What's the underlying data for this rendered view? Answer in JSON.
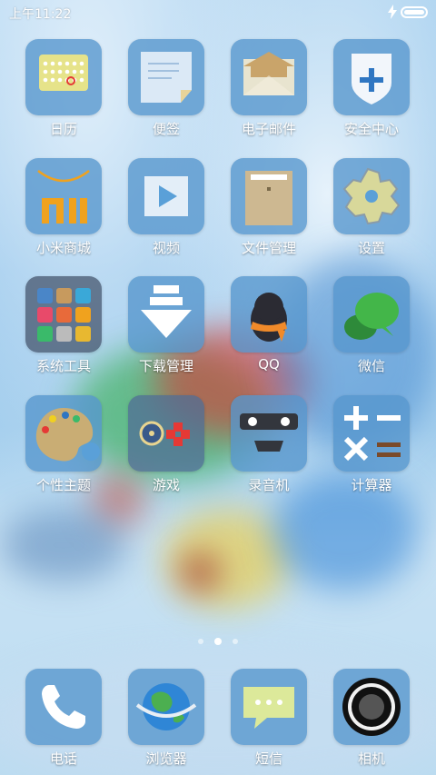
{
  "status_bar": {
    "time": "上午11:22",
    "charging": true,
    "battery_level": 1.0
  },
  "pager": {
    "page_count": 3,
    "active_page": 2
  },
  "apps": [
    {
      "label": "日历",
      "icon": "calendar-icon"
    },
    {
      "label": "便签",
      "icon": "notes-icon"
    },
    {
      "label": "电子邮件",
      "icon": "email-icon"
    },
    {
      "label": "安全中心",
      "icon": "security-icon"
    },
    {
      "label": "小米商城",
      "icon": "mi-store-icon"
    },
    {
      "label": "视频",
      "icon": "video-icon"
    },
    {
      "label": "文件管理",
      "icon": "file-manager-icon"
    },
    {
      "label": "设置",
      "icon": "settings-gear-icon"
    },
    {
      "label": "系统工具",
      "icon": "system-tools-folder-icon"
    },
    {
      "label": "下载管理",
      "icon": "download-icon"
    },
    {
      "label": "QQ",
      "icon": "qq-penguin-icon"
    },
    {
      "label": "微信",
      "icon": "wechat-icon"
    },
    {
      "label": "个性主题",
      "icon": "theme-palette-icon"
    },
    {
      "label": "游戏",
      "icon": "gamepad-icon"
    },
    {
      "label": "录音机",
      "icon": "recorder-icon"
    },
    {
      "label": "计算器",
      "icon": "calculator-icon"
    }
  ],
  "dock": [
    {
      "label": "电话",
      "icon": "phone-icon"
    },
    {
      "label": "浏览器",
      "icon": "browser-globe-icon"
    },
    {
      "label": "短信",
      "icon": "sms-bubble-icon"
    },
    {
      "label": "相机",
      "icon": "camera-icon"
    }
  ],
  "colors": {
    "tile": "#5696cd",
    "label": "#ffffff",
    "accent_red": "#e53935"
  }
}
